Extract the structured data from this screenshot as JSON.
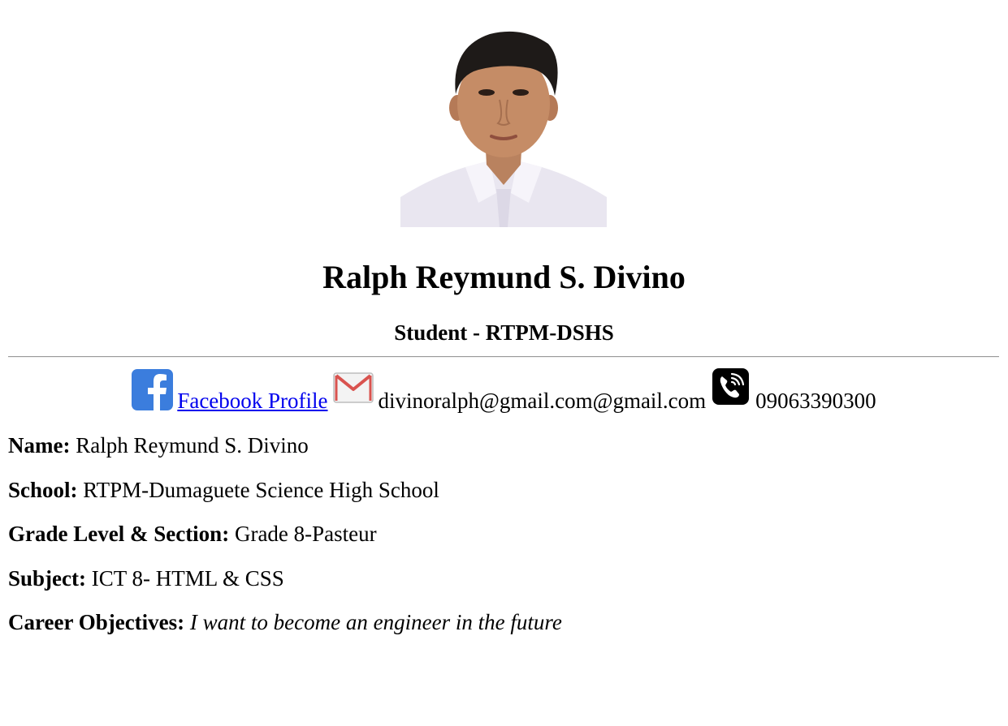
{
  "header": {
    "name": "Ralph Reymund S. Divino",
    "subtitle": "Student - RTPM-DSHS"
  },
  "contacts": {
    "facebook_icon": "facebook-icon",
    "facebook_label": "Facebook Profile",
    "mail_icon": "gmail-icon",
    "email": "divinoralph@gmail.com@gmail.com",
    "phone_icon": "phone-icon",
    "phone": "09063390300"
  },
  "details": [
    {
      "label": "Name:",
      "value": "Ralph Reymund S. Divino"
    },
    {
      "label": "School:",
      "value": "RTPM-Dumaguete Science High School"
    },
    {
      "label": "Grade Level & Section:",
      "value": "Grade 8-Pasteur"
    },
    {
      "label": "Subject:",
      "value": "ICT 8- HTML & CSS"
    },
    {
      "label": "Career Objectives:",
      "value": "I want to become an engineer in the future"
    }
  ],
  "colors": {
    "facebook": "#3b7ddd",
    "link": "#0000ee",
    "gmail_red": "#d9534f",
    "phone_bg": "#000000"
  }
}
